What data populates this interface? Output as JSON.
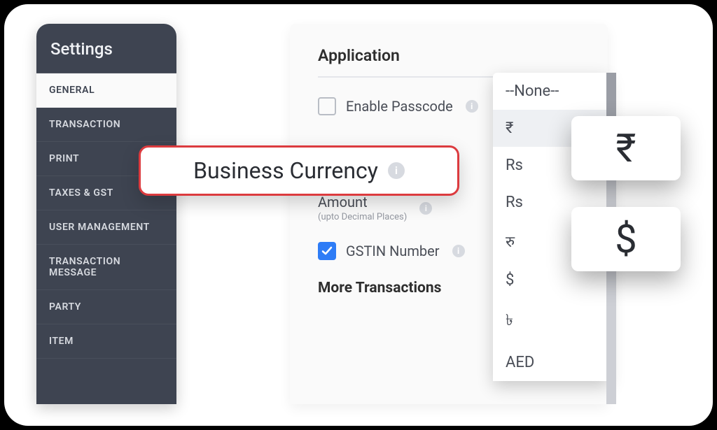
{
  "sidebar": {
    "title": "Settings",
    "items": [
      {
        "label": "GENERAL",
        "active": true
      },
      {
        "label": "TRANSACTION",
        "active": false
      },
      {
        "label": "PRINT",
        "active": false
      },
      {
        "label": "TAXES & GST",
        "active": false
      },
      {
        "label": "USER MANAGEMENT",
        "active": false
      },
      {
        "label": "TRANSACTION MESSAGE",
        "active": false
      },
      {
        "label": "PARTY",
        "active": false
      },
      {
        "label": "ITEM",
        "active": false
      }
    ]
  },
  "panel": {
    "heading": "Application",
    "enable_passcode_label": "Enable Passcode",
    "amount_label": "Amount",
    "amount_sub": "(upto Decimal Places)",
    "gstin_label": "GSTIN Number",
    "more_heading": "More Transactions"
  },
  "callout": {
    "text": "Business Currency"
  },
  "dropdown": {
    "options": [
      "--None--",
      "₹",
      "Rs",
      "Rs",
      "रु",
      "$",
      "৳",
      "AED"
    ]
  },
  "chips": {
    "rupee": "₹",
    "dollar": "$"
  }
}
